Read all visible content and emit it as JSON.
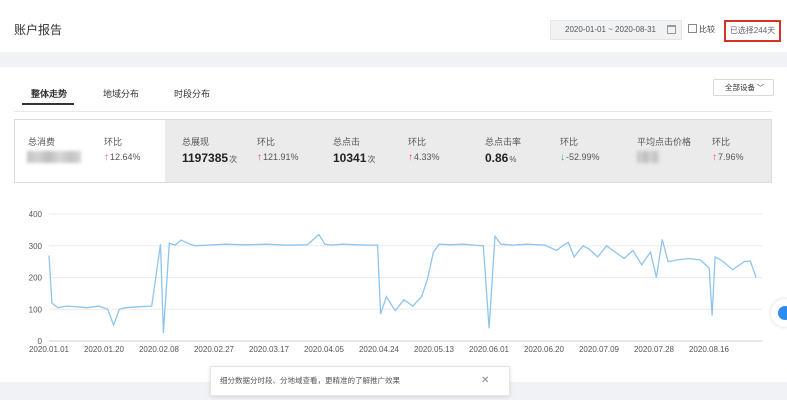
{
  "header": {
    "title": "账户报告",
    "date_range": "2020-01-01 ~ 2020-08-31",
    "compare_label": "比较",
    "days_selected": "已选择244天"
  },
  "tabs": [
    {
      "label": "整体走势",
      "active": true
    },
    {
      "label": "地域分布",
      "active": false
    },
    {
      "label": "时段分布",
      "active": false
    }
  ],
  "device_select": {
    "value": "全部设备"
  },
  "metrics": [
    {
      "label": "总消费",
      "value": "",
      "change_label": "环比",
      "direction": "up",
      "change": "12.64%",
      "value_blurred": true
    },
    {
      "label": "总展现",
      "value": "1197385",
      "unit": "次",
      "change_label": "环比",
      "direction": "up",
      "change": "121.91%"
    },
    {
      "label": "总点击",
      "value": "10341",
      "unit": "次",
      "change_label": "环比",
      "direction": "up",
      "change": "4.33%"
    },
    {
      "label": "总点击率",
      "value": "0.86",
      "unit": "%",
      "change_label": "环比",
      "direction": "down",
      "change": "-52.99%"
    },
    {
      "label": "平均点击价格",
      "value": "",
      "change_label": "环比",
      "direction": "up",
      "change": "7.96%",
      "value_blurred": true
    }
  ],
  "colors": {
    "line": "#8ec5ef",
    "up": "#e84d4d",
    "down": "#3fa36b",
    "highlight": "#d93025"
  },
  "chart_data": {
    "type": "line",
    "ylim": [
      0,
      400
    ],
    "yticks": [
      0,
      100,
      200,
      300,
      400
    ],
    "xlabels": [
      "2020.01.01",
      "2020.01.20",
      "2020.02.08",
      "2020.02.27",
      "2020.03.17",
      "2020.04.05",
      "2020.04.24",
      "2020.05.13",
      "2020.06.01",
      "2020.06.20",
      "2020.07.09",
      "2020.07.28",
      "2020.08.16"
    ],
    "grid": "horizontal",
    "series": [
      {
        "x": [
          "2020-01-01",
          "2020-01-02",
          "2020-01-04",
          "2020-01-07",
          "2020-01-10",
          "2020-01-14",
          "2020-01-18",
          "2020-01-21",
          "2020-01-23",
          "2020-01-25",
          "2020-01-27",
          "2020-02-01",
          "2020-02-05",
          "2020-02-08",
          "2020-02-09",
          "2020-02-11",
          "2020-02-12",
          "2020-02-13",
          "2020-02-15",
          "2020-02-18",
          "2020-02-20",
          "2020-02-24",
          "2020-03-01",
          "2020-03-08",
          "2020-03-15",
          "2020-03-22",
          "2020-03-29",
          "2020-04-02",
          "2020-04-04",
          "2020-04-06",
          "2020-04-10",
          "2020-04-15",
          "2020-04-20",
          "2020-04-22",
          "2020-04-23",
          "2020-04-25",
          "2020-04-28",
          "2020-05-01",
          "2020-05-04",
          "2020-05-07",
          "2020-05-09",
          "2020-05-11",
          "2020-05-13",
          "2020-05-17",
          "2020-05-21",
          "2020-05-25",
          "2020-05-28",
          "2020-05-30",
          "2020-06-01",
          "2020-06-03",
          "2020-06-07",
          "2020-06-12",
          "2020-06-18",
          "2020-06-22",
          "2020-06-24",
          "2020-06-26",
          "2020-06-28",
          "2020-07-01",
          "2020-07-03",
          "2020-07-06",
          "2020-07-09",
          "2020-07-12",
          "2020-07-15",
          "2020-07-18",
          "2020-07-21",
          "2020-07-24",
          "2020-07-26",
          "2020-07-28",
          "2020-07-30",
          "2020-08-02",
          "2020-08-06",
          "2020-08-10",
          "2020-08-13",
          "2020-08-14",
          "2020-08-15",
          "2020-08-17",
          "2020-08-21",
          "2020-08-25",
          "2020-08-27",
          "2020-08-29"
        ],
        "y": [
          270,
          120,
          105,
          110,
          108,
          105,
          110,
          100,
          50,
          100,
          105,
          108,
          110,
          305,
          25,
          308,
          305,
          302,
          318,
          305,
          300,
          302,
          305,
          303,
          305,
          302,
          303,
          335,
          305,
          302,
          305,
          303,
          302,
          302,
          85,
          140,
          95,
          130,
          110,
          140,
          195,
          280,
          305,
          303,
          305,
          302,
          300,
          40,
          330,
          305,
          302,
          305,
          302,
          285,
          300,
          310,
          265,
          300,
          290,
          265,
          300,
          280,
          260,
          285,
          240,
          280,
          200,
          320,
          250,
          255,
          260,
          255,
          230,
          80,
          265,
          255,
          225,
          250,
          252,
          200
        ]
      }
    ]
  },
  "toast": {
    "message": "细分数据分时段、分地域查看，更精准的了解推广效果"
  },
  "help_icon": "chat-help-icon"
}
